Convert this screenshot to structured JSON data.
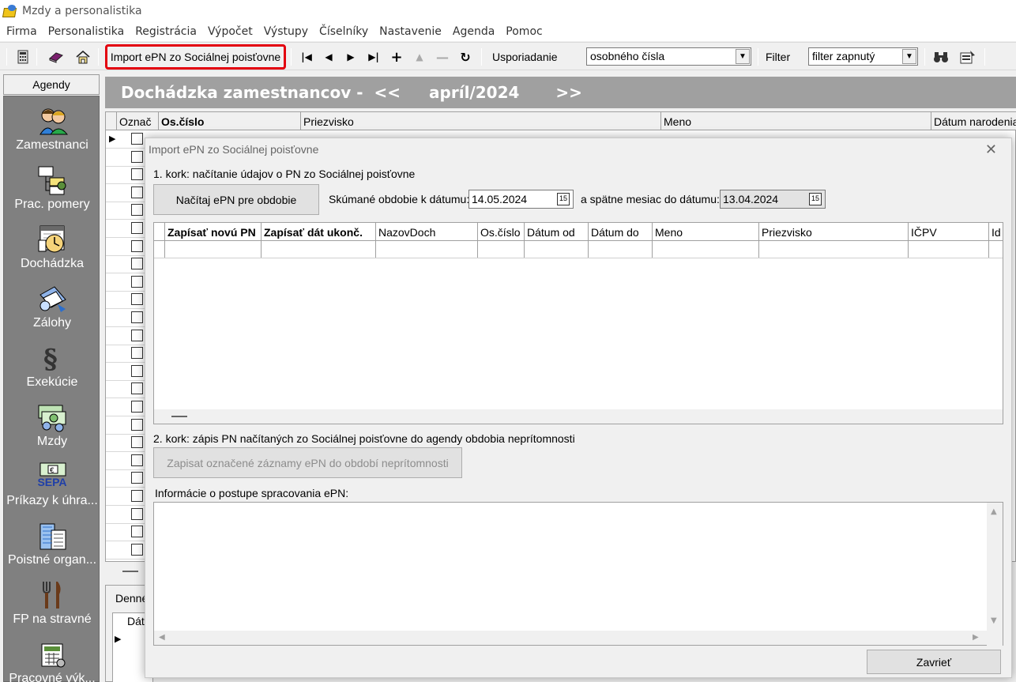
{
  "app": {
    "title": "Mzdy a personalistika"
  },
  "menu": [
    "Firma",
    "Personalistika",
    "Registrácia",
    "Výpočet",
    "Výstupy",
    "Číselníky",
    "Nastavenie",
    "Agenda",
    "Pomoc"
  ],
  "toolbar": {
    "import_label": "Import ePN zo Sociálnej poisťovne",
    "sort_label": "Usporiadanie",
    "sort_value": "osobného čísla",
    "filter_label": "Filter",
    "filter_value": "filter zapnutý",
    "highlight_color": "#e3000f"
  },
  "sidebar": {
    "header": "Agendy",
    "items": [
      {
        "label": "Zamestnanci",
        "icon": "employees-icon"
      },
      {
        "label": "Prac. pomery",
        "icon": "org-chart-icon"
      },
      {
        "label": "Dochádzka",
        "icon": "calendar-clock-icon"
      },
      {
        "label": "Zálohy",
        "icon": "money-icon"
      },
      {
        "label": "Exekúcie",
        "icon": "paragraph-icon"
      },
      {
        "label": "Mzdy",
        "icon": "cash-icon"
      },
      {
        "label": "Príkazy k úhra...",
        "icon": "sepa-icon",
        "badge": "SEPA"
      },
      {
        "label": "Poistné organ...",
        "icon": "building-icon"
      },
      {
        "label": "FP na stravné",
        "icon": "cutlery-icon"
      },
      {
        "label": "Pracovné výk...",
        "icon": "calculator-icon"
      }
    ]
  },
  "main": {
    "header_title": "Dochádzka zamestnancov -",
    "prev": "<<",
    "period": "apríl/2024",
    "next": ">>",
    "columns": [
      "Označ",
      "Os.číslo",
      "Priezvisko",
      "Meno",
      "Dátum narodenia"
    ],
    "bottom_tab": "Denné",
    "bottom_col": "Dátu"
  },
  "dialog": {
    "title": "Import ePN zo Sociálnej poisťovne",
    "step1": "1. kork: načítanie údajov o PN zo Sociálnej poisťovne",
    "load_button": "Načítaj ePN pre obdobie",
    "date_label": "Skúmané obdobie k dátumu:",
    "date_value": "14.05.2024",
    "back_label": "a spätne mesiac do dátumu:",
    "back_value": "13.04.2024",
    "cal_glyph": "15",
    "columns": [
      "Zapísať novú PN",
      "Zapísať dát ukonč.",
      "NazovDoch",
      "Os.číslo",
      "Dátum od",
      "Dátum do",
      "Meno",
      "Priezvisko",
      "IČPV",
      "Id"
    ],
    "step2": "2. kork: zápis PN načítaných zo Sociálnej poisťovne do agendy obdobia neprítomnosti",
    "write_button": "Zapisat označené záznamy ePN do období neprítomnosti",
    "info_label": "Informácie o postupe spracovania ePN:",
    "close_button": "Zavrieť"
  }
}
